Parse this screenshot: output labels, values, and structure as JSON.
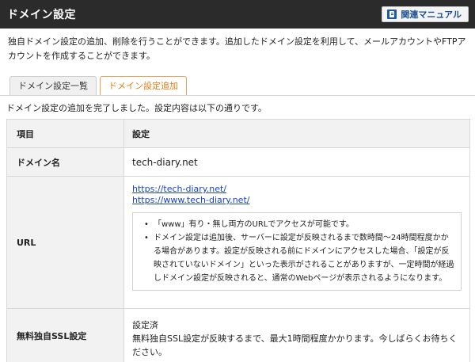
{
  "header": {
    "title": "ドメイン設定",
    "manual_label": "関連マニュアル"
  },
  "description": "独自ドメイン設定の追加、削除を行うことができます。追加したドメイン設定を利用して、メールアカウントやFTPアカウントを作成することができます。",
  "tabs": [
    {
      "label": "ドメイン設定一覧",
      "active": false
    },
    {
      "label": "ドメイン設定追加",
      "active": true
    }
  ],
  "completion_message": "ドメイン設定の追加を完了しました。設定内容は以下の通りです。",
  "table": {
    "header": {
      "item": "項目",
      "setting": "設定"
    },
    "domain": {
      "label": "ドメイン名",
      "value": "tech-diary.net"
    },
    "url": {
      "label": "URL",
      "links": [
        "https://tech-diary.net/",
        "https://www.tech-diary.net/"
      ],
      "notes": [
        "「www」有り・無し両方のURLでアクセスが可能です。",
        "ドメイン設定は追加後、サーバーに設定が反映されるまで数時間〜24時間程度かかる場合があります。設定が反映される前にドメインにアクセスした場合、「設定が反映されていないドメイン」といった表示がされることがありますが、一定時間が経過しドメイン設定が反映されると、通常のWebページが表示されるようになります。"
      ]
    },
    "ssl": {
      "label": "無料独自SSL設定",
      "status": "設定済",
      "note": "無料独自SSL設定が反映するまで、最大1時間程度かかります。今しばらくお待ちください。"
    }
  },
  "colors": {
    "header_bg": "#2b2b2b",
    "active_tab": "#e67e16",
    "link": "#1a43c4",
    "manual_label": "#1c4f94"
  }
}
